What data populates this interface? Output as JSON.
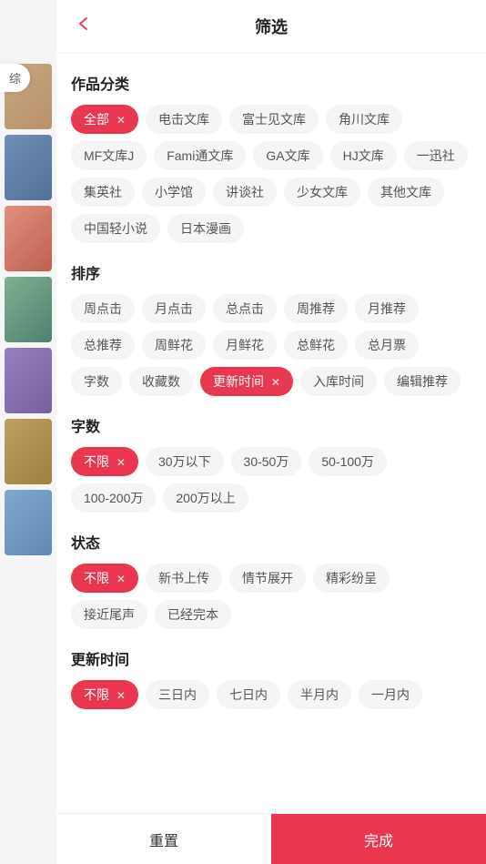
{
  "header": {
    "title": "筛选",
    "back_icon": "‹"
  },
  "sections": {
    "category": {
      "title": "作品分类",
      "tags": [
        {
          "label": "全部",
          "active": true,
          "has_close": true
        },
        {
          "label": "电击文库",
          "active": false
        },
        {
          "label": "富士见文库",
          "active": false
        },
        {
          "label": "角川文库",
          "active": false
        },
        {
          "label": "MF文库J",
          "active": false
        },
        {
          "label": "Fami通文库",
          "active": false
        },
        {
          "label": "GA文库",
          "active": false
        },
        {
          "label": "HJ文库",
          "active": false
        },
        {
          "label": "一迅社",
          "active": false
        },
        {
          "label": "集英社",
          "active": false
        },
        {
          "label": "小学馆",
          "active": false
        },
        {
          "label": "讲谈社",
          "active": false
        },
        {
          "label": "少女文库",
          "active": false
        },
        {
          "label": "其他文库",
          "active": false
        },
        {
          "label": "中国轻小说",
          "active": false
        },
        {
          "label": "日本漫画",
          "active": false
        }
      ]
    },
    "sort": {
      "title": "排序",
      "tags": [
        {
          "label": "周点击",
          "active": false
        },
        {
          "label": "月点击",
          "active": false
        },
        {
          "label": "总点击",
          "active": false
        },
        {
          "label": "周推荐",
          "active": false
        },
        {
          "label": "月推荐",
          "active": false
        },
        {
          "label": "总推荐",
          "active": false
        },
        {
          "label": "周鲜花",
          "active": false
        },
        {
          "label": "月鲜花",
          "active": false
        },
        {
          "label": "总鲜花",
          "active": false
        },
        {
          "label": "总月票",
          "active": false
        },
        {
          "label": "字数",
          "active": false
        },
        {
          "label": "收藏数",
          "active": false
        },
        {
          "label": "更新时间",
          "active": true,
          "has_close": true
        },
        {
          "label": "入库时间",
          "active": false
        },
        {
          "label": "编辑推荐",
          "active": false
        }
      ]
    },
    "wordcount": {
      "title": "字数",
      "tags": [
        {
          "label": "不限",
          "active": true,
          "has_close": true
        },
        {
          "label": "30万以下",
          "active": false
        },
        {
          "label": "30-50万",
          "active": false
        },
        {
          "label": "50-100万",
          "active": false
        },
        {
          "label": "100-200万",
          "active": false
        },
        {
          "label": "200万以上",
          "active": false
        }
      ]
    },
    "status": {
      "title": "状态",
      "tags": [
        {
          "label": "不限",
          "active": true,
          "has_close": true
        },
        {
          "label": "新书上传",
          "active": false
        },
        {
          "label": "情节展开",
          "active": false
        },
        {
          "label": "精彩纷呈",
          "active": false
        },
        {
          "label": "接近尾声",
          "active": false
        },
        {
          "label": "已经完本",
          "active": false
        }
      ]
    },
    "update_time": {
      "title": "更新时间",
      "tags": [
        {
          "label": "不限",
          "active": true,
          "has_close": true
        },
        {
          "label": "三日内",
          "active": false
        },
        {
          "label": "七日内",
          "active": false
        },
        {
          "label": "半月内",
          "active": false
        },
        {
          "label": "一月内",
          "active": false
        }
      ]
    }
  },
  "footer": {
    "reset_label": "重置",
    "confirm_label": "完成"
  },
  "sidebar": {
    "tab_label": "综"
  },
  "colors": {
    "active_bg": "#e8374e",
    "active_text": "#fff"
  }
}
